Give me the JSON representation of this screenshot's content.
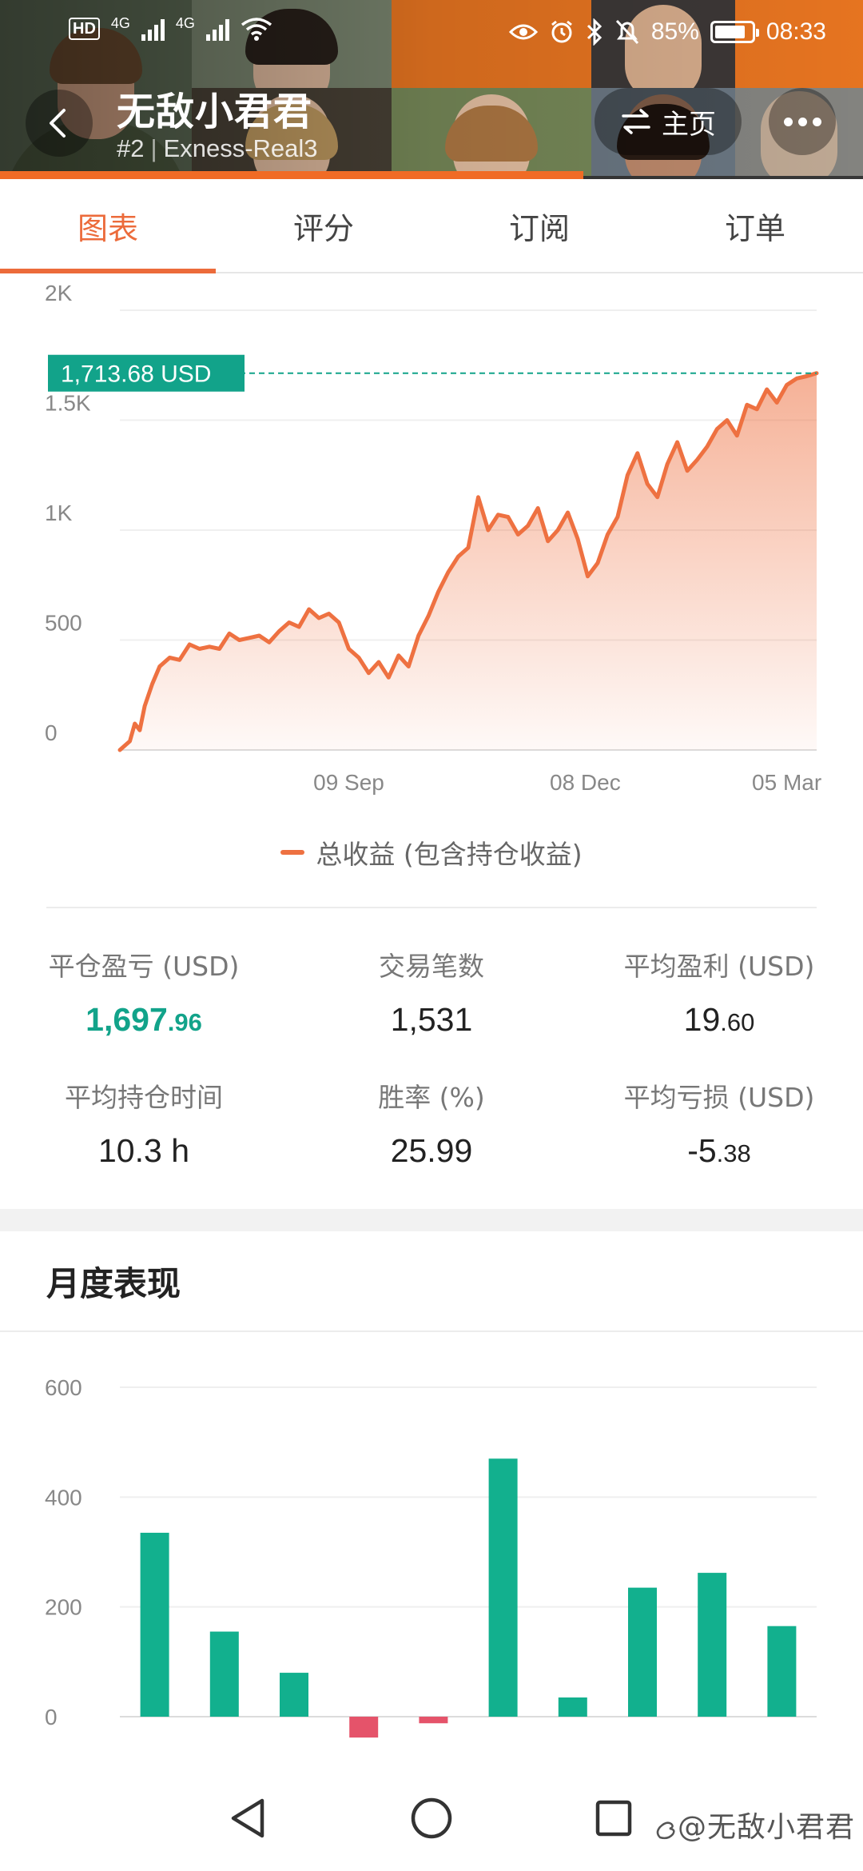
{
  "status_bar": {
    "hd_label": "HD",
    "network_1": "4G",
    "network_2": "4G",
    "battery_percent": "85%",
    "battery_level": 0.85,
    "time": "08:33",
    "icons": [
      "hd-icon",
      "signal-icon",
      "signal-icon",
      "wifi-icon",
      "eye-icon",
      "alarm-icon",
      "bluetooth-icon",
      "mute-icon",
      "battery-icon"
    ]
  },
  "header": {
    "account_name": "无敌小君君",
    "rank": "#2",
    "server": "Exness-Real3",
    "home_label": "主页",
    "icons": [
      "back-icon",
      "swap-icon",
      "more-icon"
    ]
  },
  "tabs": [
    {
      "label": "图表",
      "active": true
    },
    {
      "label": "评分",
      "active": false
    },
    {
      "label": "订阅",
      "active": false
    },
    {
      "label": "订单",
      "active": false
    }
  ],
  "chart_data": [
    {
      "type": "area",
      "y_ticks": [
        "2K",
        "1.5K",
        "1K",
        "500",
        "0"
      ],
      "ylim": [
        0,
        2000
      ],
      "x_ticks": [
        "09 Sep",
        "08 Dec",
        "05 Mar"
      ],
      "current_value_label": "1,713.68 USD",
      "current_value": 1713.68,
      "legend": "总收益 (包含持仓收益)",
      "color": "#ee7141",
      "grid": true,
      "x_index": [
        0,
        2,
        4,
        6,
        8,
        10,
        13,
        16,
        20,
        24,
        28,
        32,
        36,
        40,
        44,
        48,
        52,
        56,
        60,
        64,
        68,
        72,
        76,
        80,
        84,
        88,
        92,
        96,
        100,
        104,
        108,
        112,
        116,
        120,
        124,
        128,
        132,
        136,
        140,
        144,
        148,
        152,
        156,
        160,
        164,
        168,
        172,
        176,
        180,
        184,
        188,
        192,
        196,
        200,
        204,
        208,
        212,
        216,
        220,
        224,
        228,
        232,
        236,
        240,
        244,
        248,
        252,
        256,
        260,
        264,
        268,
        272,
        276,
        280
      ],
      "values": [
        0,
        20,
        40,
        120,
        90,
        200,
        300,
        380,
        420,
        410,
        480,
        460,
        470,
        460,
        530,
        500,
        510,
        520,
        490,
        540,
        580,
        560,
        640,
        600,
        620,
        580,
        460,
        420,
        350,
        400,
        330,
        430,
        380,
        520,
        610,
        720,
        810,
        880,
        920,
        1150,
        1000,
        1070,
        1060,
        980,
        1020,
        1100,
        950,
        1000,
        1080,
        960,
        790,
        850,
        980,
        1060,
        1250,
        1350,
        1210,
        1150,
        1300,
        1400,
        1270,
        1320,
        1380,
        1460,
        1500,
        1430,
        1570,
        1550,
        1640,
        1580,
        1660,
        1690,
        1700,
        1713.68
      ],
      "x_tick_index": [
        92,
        187,
        268
      ]
    },
    {
      "type": "bar",
      "y_ticks": [
        "600",
        "400",
        "200",
        "0"
      ],
      "ylim": [
        -50,
        600
      ],
      "values": [
        335,
        155,
        80,
        -38,
        -12,
        470,
        35,
        235,
        262,
        165
      ],
      "positive_color": "#12b08e",
      "negative_color": "#e5536a",
      "grid": true
    }
  ],
  "stats": [
    {
      "label": "平仓盈亏 (USD)",
      "int": "1,697",
      "dec": ".96",
      "positive": true
    },
    {
      "label": "交易笔数",
      "int": "1,531",
      "dec": "",
      "positive": false
    },
    {
      "label": "平均盈利 (USD)",
      "int": "19",
      "dec": ".60",
      "positive": false
    },
    {
      "label": "平均持仓时间",
      "int": "10.3 h",
      "dec": "",
      "positive": false
    },
    {
      "label": "胜率 (%)",
      "int": "25.99",
      "dec": "",
      "positive": false
    },
    {
      "label": "平均亏损 (USD)",
      "int": "-5",
      "dec": ".38",
      "positive": false
    }
  ],
  "monthly": {
    "title": "月度表现"
  },
  "navbar": {
    "watermark": "@无敌小君君",
    "icons": [
      "nav-back-icon",
      "nav-home-icon",
      "nav-recents-icon",
      "weibo-icon"
    ]
  }
}
